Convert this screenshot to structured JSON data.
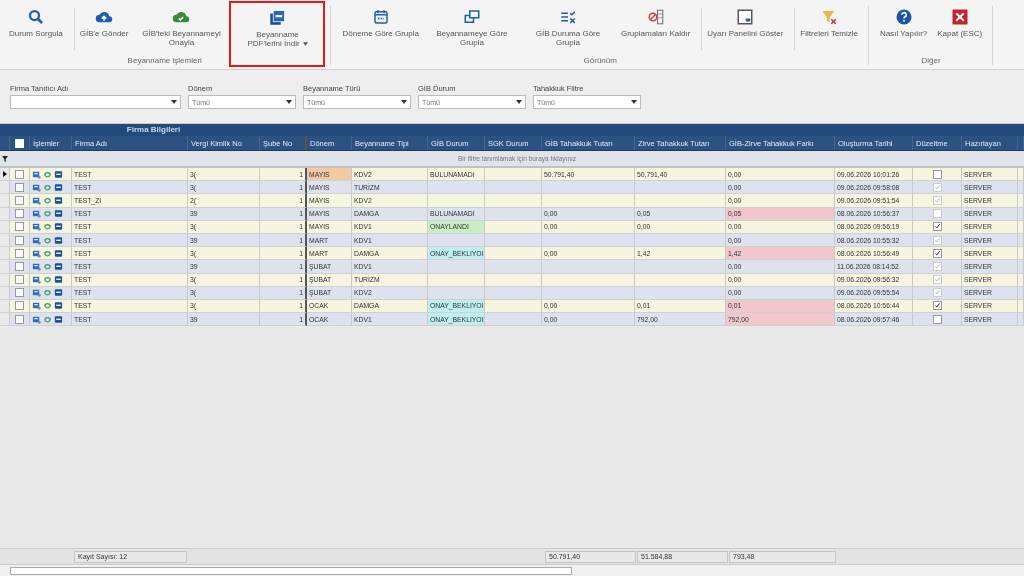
{
  "ribbon": {
    "groups": [
      {
        "label": "Beyanname işlemleri",
        "buttons": [
          {
            "kind": "search",
            "label": "Durum Sorgula",
            "separated": false,
            "highlighted": false,
            "dropdown": false
          },
          {
            "kind": "upload",
            "label": "GİB'e Gönder",
            "separated": true,
            "highlighted": false,
            "dropdown": false
          },
          {
            "kind": "approve",
            "label": "GİB'teki Beyannameyi Onayla",
            "separated": false,
            "highlighted": false,
            "dropdown": false
          },
          {
            "kind": "pdf",
            "label": "Beyanname PDF'lerini İndir",
            "separated": false,
            "highlighted": true,
            "dropdown": true
          }
        ]
      },
      {
        "label": "Görünüm",
        "buttons": [
          {
            "kind": "calendar",
            "label": "Döneme Göre Grupla",
            "separated": false,
            "highlighted": false,
            "dropdown": false
          },
          {
            "kind": "windows",
            "label": "Beyannameye Göre Grupla",
            "separated": false,
            "highlighted": false,
            "dropdown": false
          },
          {
            "kind": "list",
            "label": "GİB Duruma Göre Grupla",
            "separated": false,
            "highlighted": false,
            "dropdown": false
          },
          {
            "kind": "ungroup",
            "label": "Gruplamaları Kaldır",
            "separated": false,
            "highlighted": false,
            "dropdown": false
          },
          {
            "kind": "panel",
            "label": "Uyarı Panelini Göster",
            "separated": true,
            "highlighted": false,
            "dropdown": false
          },
          {
            "kind": "filter",
            "label": "Filtreleri Temizle",
            "separated": true,
            "highlighted": false,
            "dropdown": false
          }
        ]
      },
      {
        "label": "Diğer",
        "buttons": [
          {
            "kind": "help",
            "label": "Nasıl Yapılır?",
            "separated": false,
            "highlighted": false,
            "dropdown": false
          },
          {
            "kind": "close",
            "label": "Kapat (ESC)",
            "separated": false,
            "highlighted": false,
            "dropdown": false
          }
        ]
      }
    ]
  },
  "filters": [
    {
      "label": "Firma Tanıtıcı Adı"
    },
    {
      "label": "Dönem",
      "value": "Tümü"
    },
    {
      "label": "Beyanname Türü",
      "value": "Tümü"
    },
    {
      "label": "GİB Durum",
      "value": "Tümü"
    },
    {
      "label": "Tahakkuk Filtre",
      "value": "Tümü"
    }
  ],
  "table": {
    "band": "Firma Bilgileri",
    "select_all_checked": false,
    "columns": [
      "İşlemler",
      "Firma Adı",
      "Vergi Kimlik No",
      "Şube No",
      "Dönem",
      "Beyanname Tipi",
      "GİB Durum",
      "SGK Durum",
      "GİB Tahakkuk Tutarı",
      "Zirve Tahakkuk Tutarı",
      "GİB-Zirve Tahakkuk Farkı",
      "Oluşturma Tarihi",
      "Düzeltme",
      "Hazırlayan"
    ],
    "filter_hint": "Bir filtre tanımlamak için buraya tıklayınız",
    "rows": [
      {
        "focused": true,
        "checked": false,
        "firm": "TEST",
        "vkn": "3(",
        "sube": "1",
        "donem": "MAYIS",
        "tip": "KDV2",
        "gib": "BULUNAMADI",
        "gib_tahakkuk": "50.791,40",
        "zirve": "50.791,40",
        "fark": "0,00",
        "fark_alert": false,
        "tarih": "09.06.2026 10:01:26",
        "duzeltme": false,
        "duzeltme_disabled": false,
        "hazirlayan": "SERVER"
      },
      {
        "focused": false,
        "checked": false,
        "firm": "TEST",
        "vkn": "3(",
        "sube": "1",
        "donem": "MAYIS",
        "tip": "TURİZM",
        "fark": "0,00",
        "fark_alert": false,
        "tarih": "09.06.2026 09:58:08",
        "duzeltme": true,
        "duzeltme_disabled": true,
        "hazirlayan": "SERVER"
      },
      {
        "focused": false,
        "checked": false,
        "firm": "TEST_Zİ",
        "vkn": "2(",
        "sube": "1",
        "donem": "MAYIS",
        "tip": "KDV2",
        "fark": "0,00",
        "fark_alert": false,
        "tarih": "09.06.2026 09:51:54",
        "duzeltme": true,
        "duzeltme_disabled": true,
        "hazirlayan": "SERVER"
      },
      {
        "focused": false,
        "checked": false,
        "firm": "TEST",
        "vkn": "39",
        "sube": "1",
        "donem": "MAYIS",
        "tip": "DAMGA",
        "gib": "BULUNAMADI",
        "gib_tahakkuk": "0,00",
        "zirve": "0,05",
        "fark": "0,05",
        "fark_alert": true,
        "tarih": "08.06.2026 10:56:37",
        "duzeltme": false,
        "duzeltme_disabled": true,
        "hazirlayan": "SERVER"
      },
      {
        "focused": false,
        "checked": false,
        "firm": "TEST",
        "vkn": "3(",
        "sube": "1",
        "donem": "MAYIS",
        "tip": "KDV1",
        "gib": "ONAYLANDI",
        "color": "#c8efc4",
        "gib_tahakkuk": "0,00",
        "zirve": "0,00",
        "fark": "0,00",
        "fark_alert": false,
        "tarih": "08.06.2026 09:56:19",
        "duzeltme": true,
        "duzeltme_disabled": false,
        "hazirlayan": "SERVER"
      },
      {
        "focused": false,
        "checked": false,
        "firm": "TEST",
        "vkn": "39",
        "sube": "1",
        "donem": "MART",
        "tip": "KDV1",
        "fark": "0,00",
        "fark_alert": false,
        "tarih": "08.06.2026 10:55:32",
        "duzeltme": true,
        "duzeltme_disabled": true,
        "hazirlayan": "SERVER"
      },
      {
        "focused": false,
        "checked": false,
        "firm": "TEST",
        "vkn": "3(",
        "sube": "1",
        "donem": "MART",
        "tip": "DAMGA",
        "gib": "ONAY_BEKLIYOI",
        "color": "#bfeef2",
        "gib_tahakkuk": "0,00",
        "zirve": "1,42",
        "fark": "1,42",
        "fark_alert": true,
        "tarih": "08.06.2026 10:56:49",
        "duzeltme": true,
        "duzeltme_disabled": false,
        "hazirlayan": "SERVER"
      },
      {
        "focused": false,
        "checked": false,
        "firm": "TEST",
        "vkn": "39",
        "sube": "1",
        "donem": "ŞUBAT",
        "tip": "KDV1",
        "fark": "0,00",
        "fark_alert": false,
        "tarih": "11.06.2026 08:14:52",
        "duzeltme": true,
        "duzeltme_disabled": true,
        "hazirlayan": "SERVER"
      },
      {
        "focused": false,
        "checked": false,
        "firm": "TEST",
        "vkn": "3(",
        "sube": "1",
        "donem": "ŞUBAT",
        "tip": "TURİZM",
        "fark": "0,00",
        "fark_alert": false,
        "tarih": "09.06.2026 09:56:32",
        "duzeltme": true,
        "duzeltme_disabled": true,
        "hazirlayan": "SERVER"
      },
      {
        "focused": false,
        "checked": false,
        "firm": "TEST",
        "vkn": "3(",
        "sube": "1",
        "donem": "ŞUBAT",
        "tip": "KDV2",
        "fark": "0,00",
        "fark_alert": false,
        "tarih": "09.06.2026 09:55:54",
        "duzeltme": true,
        "duzeltme_disabled": true,
        "hazirlayan": "SERVER"
      },
      {
        "focused": false,
        "checked": false,
        "firm": "TEST",
        "vkn": "3(",
        "sube": "1",
        "donem": "OCAK",
        "tip": "DAMGA",
        "gib": "ONAY_BEKLIYOI",
        "color": "#bfeef2",
        "gib_tahakkuk": "0,00",
        "zirve": "0,01",
        "fark": "0,01",
        "fark_alert": true,
        "tarih": "08.06.2026 10:56:44",
        "duzeltme": true,
        "duzeltme_disabled": false,
        "hazirlayan": "SERVER"
      },
      {
        "focused": false,
        "checked": false,
        "firm": "TEST",
        "vkn": "39",
        "sube": "1",
        "donem": "OCAK",
        "tip": "KDV1",
        "gib": "ONAY_BEKLIYOI",
        "color": "#bfeef2",
        "gib_tahakkuk": "0,00",
        "zirve": "792,00",
        "fark": "792,00",
        "fark_alert": true,
        "tarih": "08.06.2026 09:57:46",
        "duzeltme": false,
        "duzeltme_disabled": false,
        "hazirlayan": "SERVER"
      }
    ]
  },
  "footer": {
    "count": "Kayıt Sayısı: 12",
    "totals": [
      "50.791,40",
      "51.584,88",
      "793,48"
    ]
  }
}
